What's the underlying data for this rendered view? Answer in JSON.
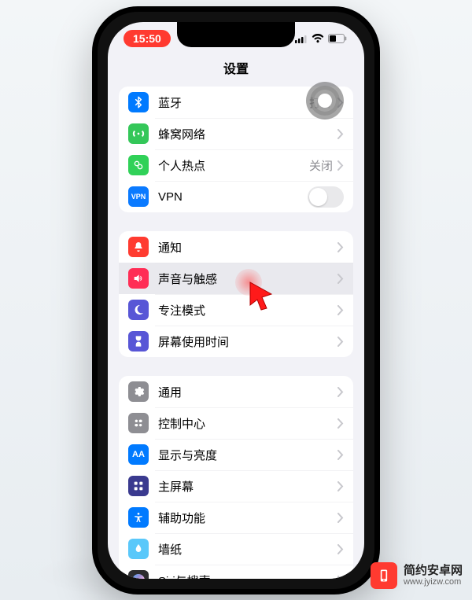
{
  "status": {
    "time": "15:50"
  },
  "nav": {
    "title": "设置"
  },
  "group1": {
    "bluetooth": {
      "label": "蓝牙",
      "value": "打开"
    },
    "cellular": {
      "label": "蜂窝网络"
    },
    "hotspot": {
      "label": "个人热点",
      "value": "关闭"
    },
    "vpn": {
      "label": "VPN"
    }
  },
  "group2": {
    "notifications": {
      "label": "通知"
    },
    "sounds": {
      "label": "声音与触感"
    },
    "focus": {
      "label": "专注模式"
    },
    "screentime": {
      "label": "屏幕使用时间"
    }
  },
  "group3": {
    "general": {
      "label": "通用"
    },
    "controlcenter": {
      "label": "控制中心"
    },
    "display": {
      "label": "显示与亮度"
    },
    "homescreen": {
      "label": "主屏幕"
    },
    "accessibility": {
      "label": "辅助功能"
    },
    "wallpaper": {
      "label": "墙纸"
    },
    "siri": {
      "label": "Siri与搜索"
    }
  },
  "watermark": {
    "title": "简约安卓网",
    "url": "www.jyizw.com"
  }
}
